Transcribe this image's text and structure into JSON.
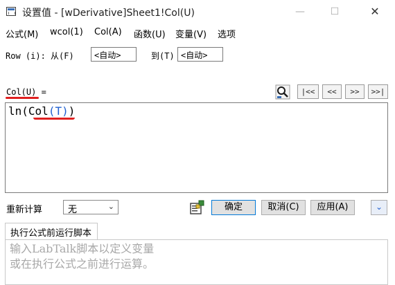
{
  "window": {
    "title": "设置值 - [wDerivative]Sheet1!Col(U)",
    "minimize": "—",
    "maximize": "☐",
    "close": "✕"
  },
  "menu": {
    "items": [
      {
        "label": "公式(M)"
      },
      {
        "label": "wcol(1)"
      },
      {
        "label": "Col(A)"
      },
      {
        "label": "函数(U)"
      },
      {
        "label": "变量(V)"
      },
      {
        "label": "选项"
      }
    ]
  },
  "row_range": {
    "label": "Row (i): 从(F)",
    "from_value": "<自动>",
    "to_label": "到(T)",
    "to_value": "<自动>"
  },
  "formula": {
    "label": "Col(U) =",
    "parts": {
      "p1": "ln(",
      "p2": "Col",
      "p3": "(",
      "p4": "T",
      "p5": ")",
      "p6": ")"
    },
    "highlight_color": "#1f5fd0",
    "annotation_color": "#e02020"
  },
  "nav_buttons": {
    "first": "|<<",
    "prev": "<<",
    "next": ">>",
    "last": ">>|"
  },
  "recalc": {
    "label": "重新计算",
    "value": "无"
  },
  "buttons": {
    "ok": "确定",
    "cancel": "取消(C)",
    "apply": "应用(A)",
    "expand": "⌄"
  },
  "before_script": {
    "tab_label": "执行公式前运行脚本",
    "placeholder": "输入LabTalk脚本以定义变量\n或在执行公式之前进行运算。"
  }
}
